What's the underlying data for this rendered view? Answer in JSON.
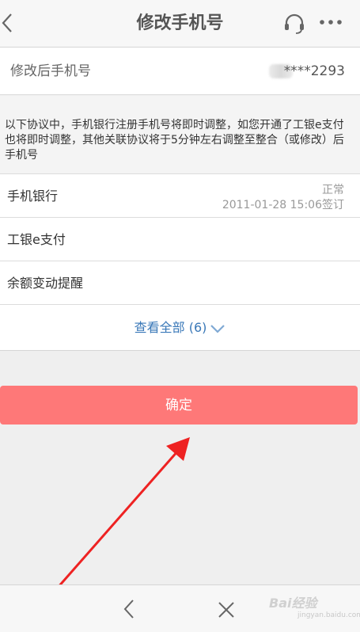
{
  "header": {
    "title": "修改手机号",
    "back_icon": "chevron-left-icon",
    "service_icon": "headset-icon",
    "more_icon": "more-dots-icon"
  },
  "phone": {
    "label": "修改后手机号",
    "value": "****2293"
  },
  "notice": {
    "text": "以下协议中，手机银行注册手机号将即时调整，如您开通了工银e支付也将即时调整，其他关联协议将于5分钟左右调整至整合（或修改）后手机号"
  },
  "list": {
    "items": [
      {
        "name": "手机银行",
        "status": "正常",
        "date": "2011-01-28 15:06签订"
      },
      {
        "name": "工银e支付",
        "status": "",
        "date": ""
      },
      {
        "name": "余额变动提醒",
        "status": "",
        "date": ""
      }
    ]
  },
  "view_all": {
    "label": "查看全部 (6)"
  },
  "confirm": {
    "label": "确定"
  },
  "bottom_bar": {
    "back_icon": "chevron-left-icon",
    "close_icon": "close-icon"
  },
  "watermark": {
    "text": "Bai经验",
    "sub": "jingyan.baidu.com"
  },
  "colors": {
    "confirm_bg": "#fe7878",
    "link": "#3a78b8",
    "annotation_arrow": "#ee2222"
  }
}
